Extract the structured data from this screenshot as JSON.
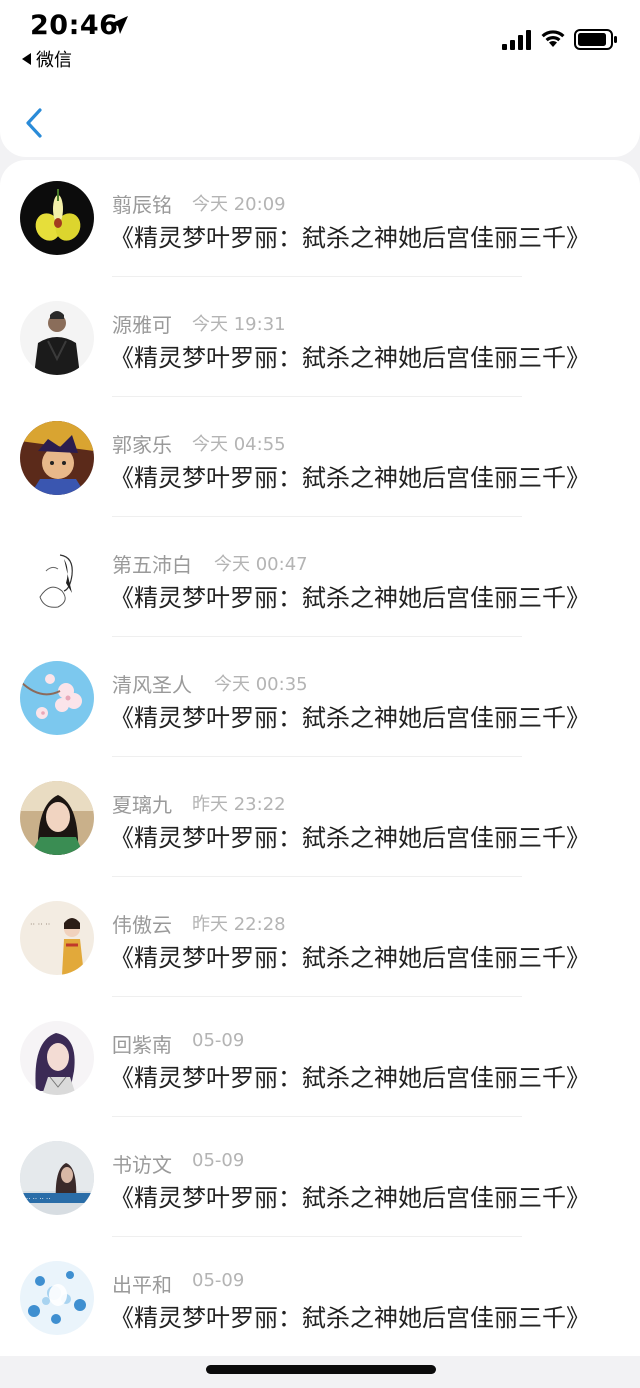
{
  "status_bar": {
    "time": "20:46",
    "back_app": "微信"
  },
  "nav": {
    "back_icon": "chevron-left-icon"
  },
  "accent_color": "#2a8bd8",
  "list": [
    {
      "name": "翦辰铭",
      "time": "今天 20:09",
      "message": "《精灵梦叶罗丽：弑杀之神她后宫佳丽三千》",
      "avatar": "yellow-orchid"
    },
    {
      "name": "源雅可",
      "time": "今天 19:31",
      "message": "《精灵梦叶罗丽：弑杀之神她后宫佳丽三千》",
      "avatar": "man-in-black"
    },
    {
      "name": "郭家乐",
      "time": "今天 04:55",
      "message": "《精灵梦叶罗丽：弑杀之神她后宫佳丽三千》",
      "avatar": "game-hero"
    },
    {
      "name": "第五沛白",
      "time": "今天 00:47",
      "message": "《精灵梦叶罗丽：弑杀之神她后宫佳丽三千》",
      "avatar": "sketch-figure"
    },
    {
      "name": "清风圣人",
      "time": "今天 00:35",
      "message": "《精灵梦叶罗丽：弑杀之神她后宫佳丽三千》",
      "avatar": "cherry-blossom"
    },
    {
      "name": "夏璃九",
      "time": "昨天 23:22",
      "message": "《精灵梦叶罗丽：弑杀之神她后宫佳丽三千》",
      "avatar": "girl-portrait"
    },
    {
      "name": "伟傲云",
      "time": "昨天 22:28",
      "message": "《精灵梦叶罗丽：弑杀之神她后宫佳丽三千》",
      "avatar": "girl-kimono"
    },
    {
      "name": "回紫南",
      "time": "05-09",
      "message": "《精灵梦叶罗丽：弑杀之神她后宫佳丽三千》",
      "avatar": "anime-girl"
    },
    {
      "name": "书访文",
      "time": "05-09",
      "message": "《精灵梦叶罗丽：弑杀之神她后宫佳丽三千》",
      "avatar": "silhouette-text"
    },
    {
      "name": "出平和",
      "time": "05-09",
      "message": "《精灵梦叶罗丽：弑杀之神她后宫佳丽三千》",
      "avatar": "blue-flowers"
    }
  ]
}
